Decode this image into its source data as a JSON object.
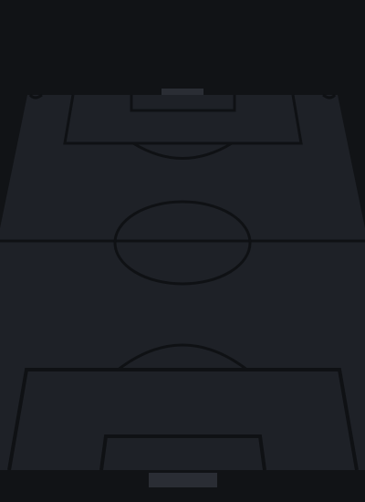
{
  "colors": {
    "background": "#111316",
    "pitch": "#1e2127",
    "lines": "#0f1114",
    "goal": "#2a2d34"
  },
  "scene": {
    "type": "soccer-pitch",
    "view": "perspective"
  }
}
